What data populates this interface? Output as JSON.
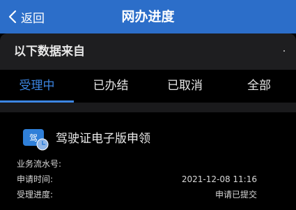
{
  "colors": {
    "header_bg": "#2c6ec9",
    "accent": "#3c86e3",
    "panel_bg": "#1e1e20",
    "page_bg": "#000000"
  },
  "header": {
    "back_label": "返回",
    "back_icon": "chevron-left-icon",
    "title": "网办进度"
  },
  "source": {
    "label": "以下数据来自"
  },
  "tabs": [
    {
      "label": "受理中",
      "active": true
    },
    {
      "label": "已办结",
      "active": false
    },
    {
      "label": "已取消",
      "active": false
    },
    {
      "label": "全部",
      "active": false
    }
  ],
  "card": {
    "icon": "driver-license-icon",
    "icon_glyph": "驾",
    "title": "驾驶证电子版申领",
    "rows": [
      {
        "label": "业务流水号:",
        "value": ""
      },
      {
        "label": "申请时间:",
        "value": "2021-12-08 11:16"
      },
      {
        "label": "受理进度:",
        "value": "申请已提交"
      }
    ]
  }
}
